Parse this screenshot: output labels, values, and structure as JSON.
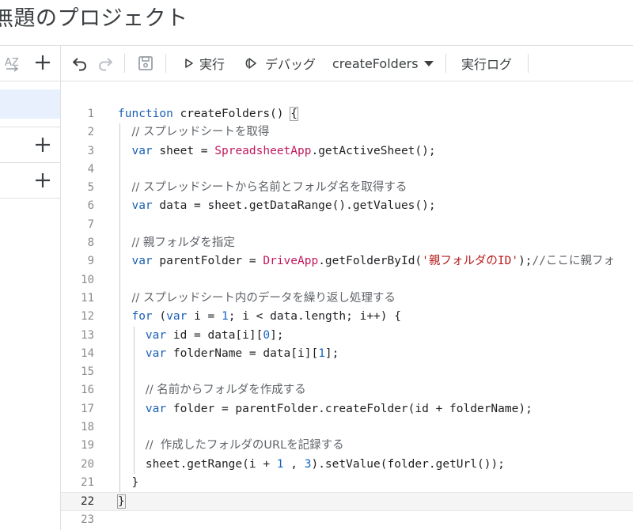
{
  "project": {
    "title": "無題のプロジェクト"
  },
  "sidebar": {
    "sort_label": "AZ"
  },
  "toolbar": {
    "run_label": "実行",
    "debug_label": "デバッグ",
    "function_name": "createFolders",
    "log_label": "実行ログ"
  },
  "editor": {
    "current_line": 22,
    "lines": [
      {
        "n": "1",
        "parts": [
          [
            "kw",
            "function"
          ],
          [
            "t",
            " createFolders() "
          ],
          [
            "br",
            "{"
          ]
        ]
      },
      {
        "n": "2",
        "parts": [
          [
            "t",
            "  "
          ],
          [
            "cm",
            "// スプレッドシートを取得"
          ]
        ]
      },
      {
        "n": "3",
        "parts": [
          [
            "t",
            "  "
          ],
          [
            "kw",
            "var"
          ],
          [
            "t",
            " sheet = "
          ],
          [
            "cls",
            "SpreadsheetApp"
          ],
          [
            "t",
            ".getActiveSheet();"
          ]
        ]
      },
      {
        "n": "4",
        "parts": []
      },
      {
        "n": "5",
        "parts": [
          [
            "t",
            "  "
          ],
          [
            "cm",
            "// スプレッドシートから名前とフォルダ名を取得する"
          ]
        ]
      },
      {
        "n": "6",
        "parts": [
          [
            "t",
            "  "
          ],
          [
            "kw",
            "var"
          ],
          [
            "t",
            " data = sheet.getDataRange().getValues();"
          ]
        ]
      },
      {
        "n": "7",
        "parts": []
      },
      {
        "n": "8",
        "parts": [
          [
            "t",
            "  "
          ],
          [
            "cm",
            "// 親フォルダを指定"
          ]
        ]
      },
      {
        "n": "9",
        "parts": [
          [
            "t",
            "  "
          ],
          [
            "kw",
            "var"
          ],
          [
            "t",
            " parentFolder = "
          ],
          [
            "cls",
            "DriveApp"
          ],
          [
            "t",
            ".getFolderById("
          ],
          [
            "str",
            "'親フォルダのID'"
          ],
          [
            "t",
            ");"
          ],
          [
            "cmm",
            "//ここに親フォ"
          ]
        ]
      },
      {
        "n": "10",
        "parts": []
      },
      {
        "n": "11",
        "parts": [
          [
            "t",
            "  "
          ],
          [
            "cm",
            "// スプレッドシート内のデータを繰り返し処理する"
          ]
        ]
      },
      {
        "n": "12",
        "parts": [
          [
            "t",
            "  "
          ],
          [
            "kw",
            "for"
          ],
          [
            "t",
            " ("
          ],
          [
            "kw",
            "var"
          ],
          [
            "t",
            " i = "
          ],
          [
            "num",
            "1"
          ],
          [
            "t",
            "; i < data.length; i++) {"
          ]
        ]
      },
      {
        "n": "13",
        "parts": [
          [
            "t",
            "    "
          ],
          [
            "kw",
            "var"
          ],
          [
            "t",
            " id = data[i]["
          ],
          [
            "num",
            "0"
          ],
          [
            "t",
            "];"
          ]
        ]
      },
      {
        "n": "14",
        "parts": [
          [
            "t",
            "    "
          ],
          [
            "kw",
            "var"
          ],
          [
            "t",
            " folderName = data[i]["
          ],
          [
            "num",
            "1"
          ],
          [
            "t",
            "];"
          ]
        ]
      },
      {
        "n": "15",
        "parts": []
      },
      {
        "n": "16",
        "parts": [
          [
            "t",
            "    "
          ],
          [
            "cm",
            "// 名前からフォルダを作成する"
          ]
        ]
      },
      {
        "n": "17",
        "parts": [
          [
            "t",
            "    "
          ],
          [
            "kw",
            "var"
          ],
          [
            "t",
            " folder = parentFolder.createFolder(id + folderName);"
          ]
        ]
      },
      {
        "n": "18",
        "parts": []
      },
      {
        "n": "19",
        "parts": [
          [
            "t",
            "    "
          ],
          [
            "cm",
            "//  作成したフォルダのURLを記録する"
          ]
        ]
      },
      {
        "n": "20",
        "parts": [
          [
            "t",
            "    sheet.getRange(i + "
          ],
          [
            "num",
            "1"
          ],
          [
            "t",
            " , "
          ],
          [
            "num",
            "3"
          ],
          [
            "t",
            ").setValue(folder.getUrl());"
          ]
        ]
      },
      {
        "n": "21",
        "parts": [
          [
            "t",
            "  }"
          ]
        ]
      },
      {
        "n": "22",
        "parts": [
          [
            "br",
            "}"
          ]
        ]
      },
      {
        "n": "23",
        "parts": []
      }
    ]
  },
  "colors": {
    "keyword": "#1a5fb4",
    "class": "#c2185b",
    "string": "#b71c1c",
    "number": "#1565c0",
    "comment": "#5f6368",
    "selected_bg": "#e8f0fe"
  }
}
